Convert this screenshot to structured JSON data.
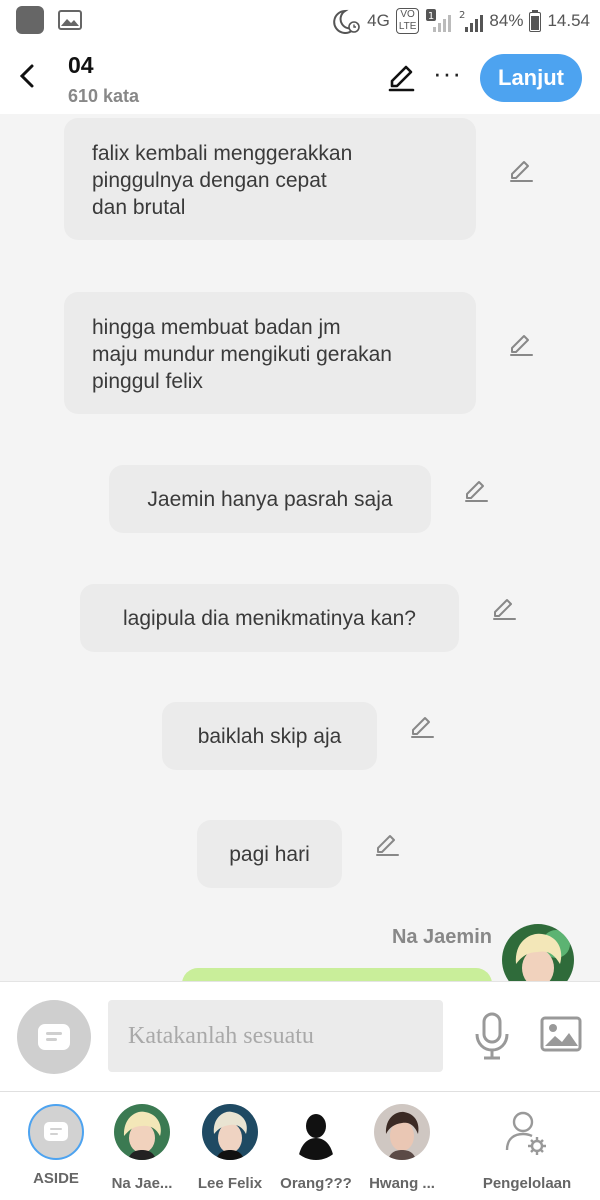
{
  "status_bar": {
    "network": "4G",
    "volte": "VO LTE",
    "sim1": "1",
    "sim2": "2",
    "battery": "84%",
    "time": "14.54"
  },
  "header": {
    "title": "04",
    "word_count": "610 kata",
    "continue_label": "Lanjut",
    "more_label": "···",
    "accent_color": "#4da3f0"
  },
  "messages": [
    {
      "text": "falix kembali menggerakkan\npinggulnya dengan cepat\ndan brutal"
    },
    {
      "text": "hingga membuat badan jm\nmaju mundur mengikuti gerakan\npinggul felix"
    },
    {
      "text": "Jaemin hanya pasrah saja"
    },
    {
      "text": "lagipula dia menikmatinya kan?"
    },
    {
      "text": "baiklah skip aja"
    },
    {
      "text": "pagi hari"
    }
  ],
  "character_message": {
    "sender": "Na Jaemin",
    "bubble_color": "#c9ee9a"
  },
  "input": {
    "placeholder": "Katakanlah sesuatu"
  },
  "bottom_nav": {
    "items": [
      {
        "label": "ASIDE",
        "icon": "aside-chat-icon"
      },
      {
        "label": "Na Jae...",
        "icon": "avatar"
      },
      {
        "label": "Lee Felix",
        "icon": "avatar"
      },
      {
        "label": "Orang???",
        "icon": "silhouette-avatar"
      },
      {
        "label": "Hwang ...",
        "icon": "avatar"
      },
      {
        "label": "Pengelolaan",
        "icon": "user-settings-icon"
      }
    ]
  }
}
